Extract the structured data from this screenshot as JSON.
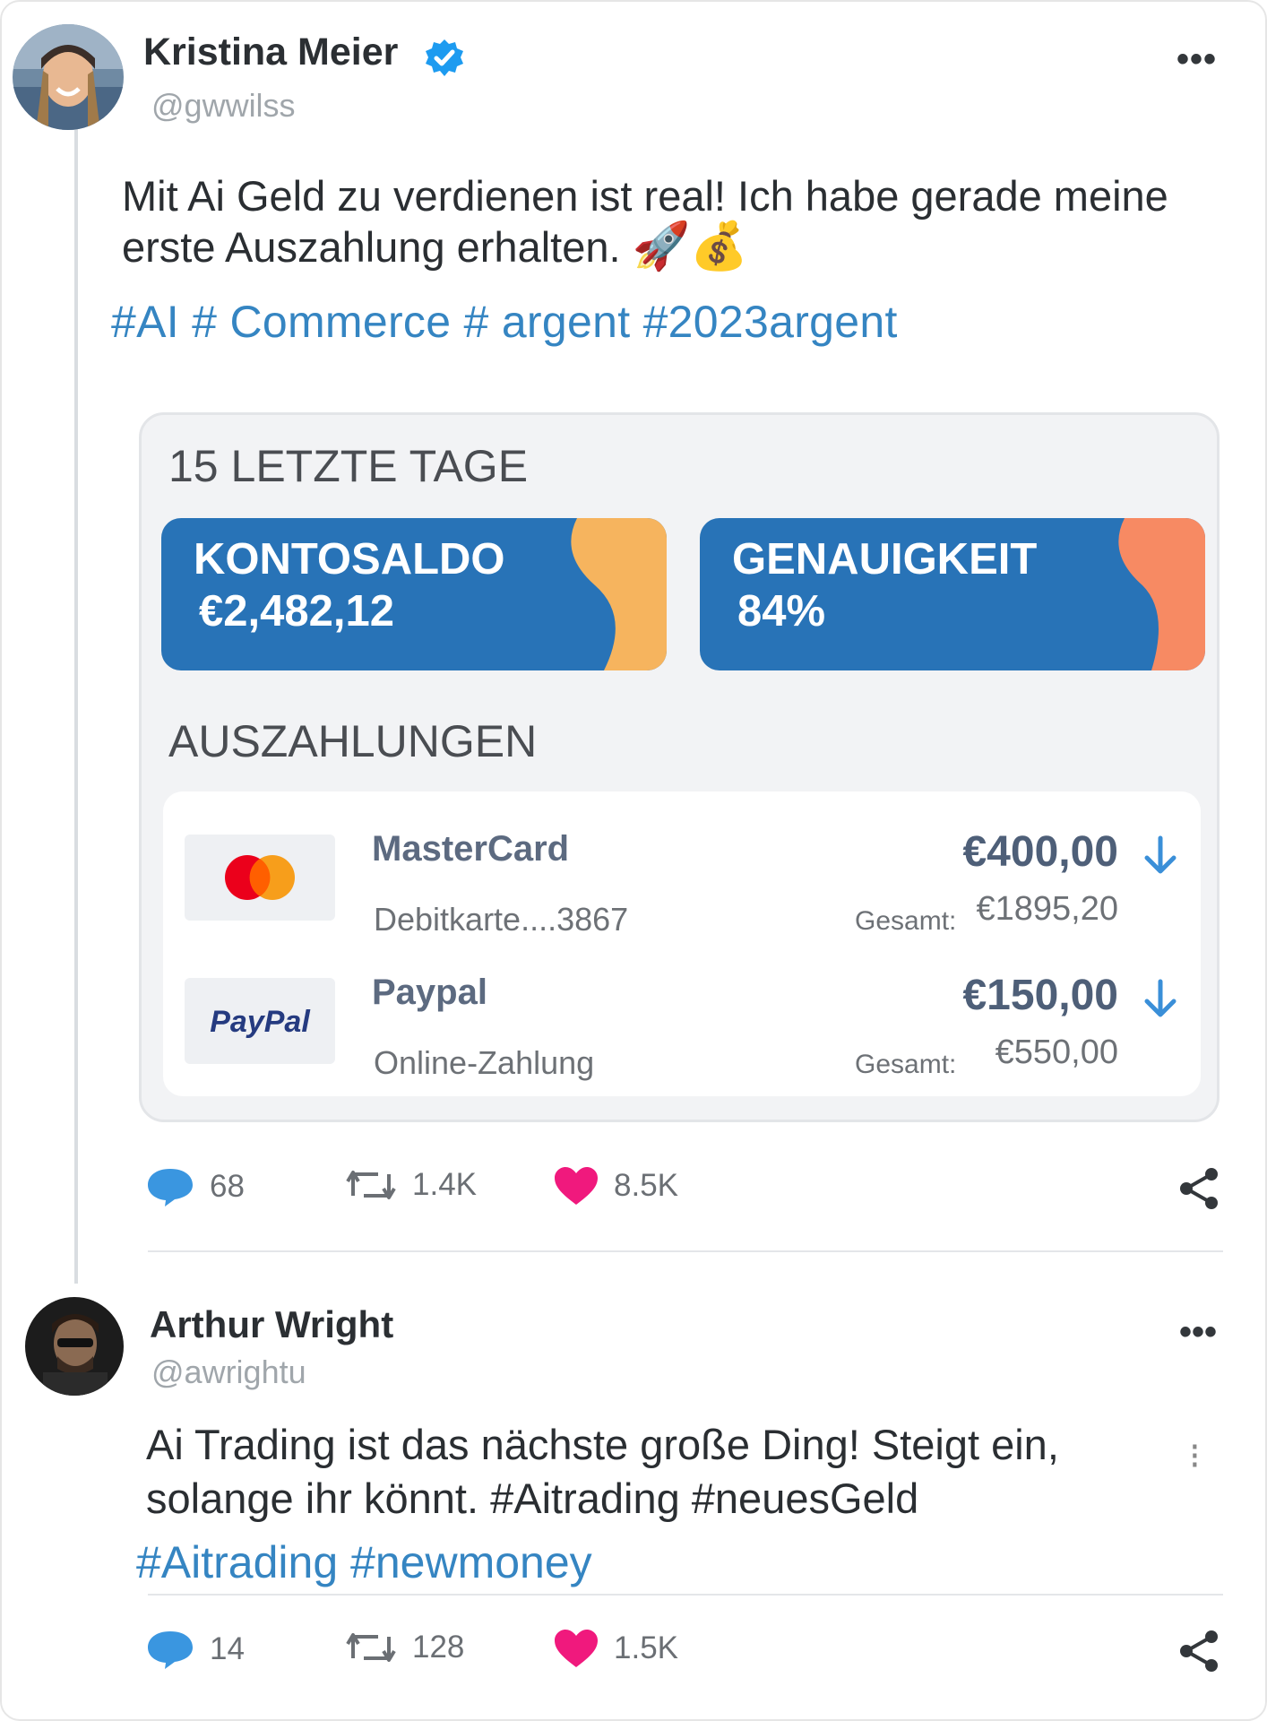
{
  "tweet1": {
    "name": "Kristina Meier",
    "handle": "@gwwilss",
    "more": "•••",
    "text": "Mit Ai Geld zu verdienen ist real! Ich habe gerade meine erste Auszahlung erhalten.",
    "emoji": "🚀💰",
    "hashtags": "#AI # Commerce # argent #2023argent",
    "stats": {
      "replies": "68",
      "retweets": "1.4K",
      "likes": "8.5K"
    }
  },
  "card": {
    "title": "15 LETZTE TAGE",
    "balance_label": "KONTOSALDO",
    "balance_value": "€2,482,12",
    "accuracy_label": "GENAUIGKEIT",
    "accuracy_value": "84%",
    "payouts_title": "AUSZAHLUNGEN",
    "payments": [
      {
        "name": "MasterCard",
        "sub": "Debitkarte....3867",
        "amount": "€400,00",
        "gesamt_label": "Gesamt:",
        "total": "€1895,20"
      },
      {
        "name": "Paypal",
        "logo_text": "PayPal",
        "sub": "Online-Zahlung",
        "amount": "€150,00",
        "gesamt_label": "Gesamt:",
        "total": "€550,00"
      }
    ]
  },
  "tweet2": {
    "name": "Arthur Wright",
    "handle": "@awrightu",
    "more": "•••",
    "text": "Ai Trading ist das nächste große Ding! Steigt ein, solange ihr könnt. #Aitrading #neuesGeld",
    "hashtags": "#Aitrading #newmoney",
    "stats": {
      "replies": "14",
      "retweets": "128",
      "likes": "1.5K"
    }
  },
  "colors": {
    "card_blue": "#2873b7",
    "accent_yellow": "#f6b45e",
    "accent_orange": "#f78a63",
    "hashtag": "#3585c2",
    "heart": "#f0197d",
    "reply_bubble": "#3a96e0"
  }
}
